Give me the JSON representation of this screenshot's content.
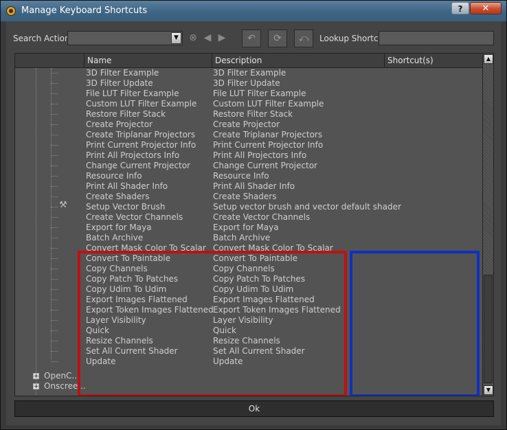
{
  "window": {
    "title": "Manage Keyboard Shortcuts",
    "help_label": "?",
    "close_label": "✕"
  },
  "toolbar": {
    "search_label": "Search Actions",
    "search_value": "",
    "lookup_label": "Lookup Shortcut",
    "lookup_value": "",
    "icons": [
      "clear-icon",
      "back-arrow-icon",
      "forward-arrow-icon",
      "undo-icon",
      "refresh-icon",
      "revert-icon"
    ]
  },
  "columns": [
    "Name",
    "Description",
    "Shortcut(s)"
  ],
  "rows": [
    {
      "name": "3D Filter Example",
      "desc": "3D Filter Example"
    },
    {
      "name": "3D Filter Update",
      "desc": "3D Filter Update"
    },
    {
      "name": "File LUT Filter Example",
      "desc": "File LUT Filter Example"
    },
    {
      "name": "Custom LUT Filter Example",
      "desc": "Custom LUT Filter Example"
    },
    {
      "name": "Restore Filter Stack",
      "desc": "Restore Filter Stack"
    },
    {
      "name": "Create Projector",
      "desc": "Create Projector"
    },
    {
      "name": "Create Triplanar Projectors",
      "desc": "Create Triplanar Projectors"
    },
    {
      "name": "Print Current Projector Info",
      "desc": "Print Current Projector Info"
    },
    {
      "name": "Print All Projectors Info",
      "desc": "Print All Projectors Info"
    },
    {
      "name": "Change Current Projector",
      "desc": "Change Current Projector"
    },
    {
      "name": "Resource Info",
      "desc": "Resource Info"
    },
    {
      "name": "Print All Shader Info",
      "desc": "Print All Shader Info"
    },
    {
      "name": "Create Shaders",
      "desc": "Create Shaders"
    },
    {
      "name": "Setup Vector Brush",
      "desc": "Setup vector brush and vector default shader",
      "icon": true
    },
    {
      "name": "Create Vector Channels",
      "desc": "Create Vector Channels"
    },
    {
      "name": "Export for Maya",
      "desc": "Export for Maya"
    },
    {
      "name": "Batch Archive",
      "desc": "Batch Archive"
    },
    {
      "name": "Convert Mask Color To Scalar",
      "desc": "Convert Mask Color To Scalar"
    },
    {
      "name": "Convert To Paintable",
      "desc": "Convert To Paintable"
    },
    {
      "name": "Copy Channels",
      "desc": "Copy Channels"
    },
    {
      "name": "Copy Patch To Patches",
      "desc": "Copy Patch To Patches"
    },
    {
      "name": "Copy Udim To Udim",
      "desc": "Copy Udim To Udim"
    },
    {
      "name": "Export Images Flattened",
      "desc": "Export Images Flattened"
    },
    {
      "name": "Export Token Images Flattened",
      "desc": "Export Token Images Flattened"
    },
    {
      "name": "Layer Visibility",
      "desc": "Layer Visibility"
    },
    {
      "name": "Quick",
      "desc": "Quick"
    },
    {
      "name": "Resize Channels",
      "desc": "Resize Channels"
    },
    {
      "name": "Set All Current Shader",
      "desc": "Set All Current Shader"
    },
    {
      "name": "Update",
      "desc": "Update"
    }
  ],
  "groups": [
    {
      "label": "OpenC...",
      "expander": "+"
    },
    {
      "label": "Onscree...",
      "expander": "+"
    }
  ],
  "ok_label": "Ok"
}
